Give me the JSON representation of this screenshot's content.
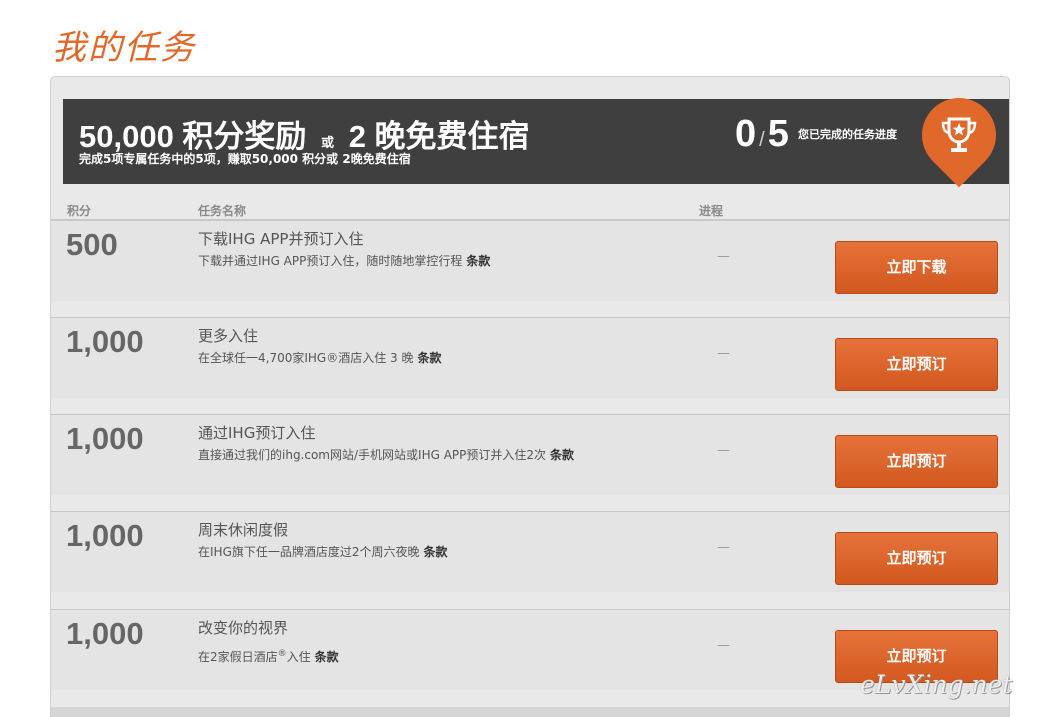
{
  "page": {
    "title": "我的任务"
  },
  "banner": {
    "points_reward": "50,000 积分奖励",
    "or_label": "或",
    "stay_reward": "2 晚免费住宿",
    "subtitle": "完成5项专属任务中的5项，赚取50,000 积分或 2晚免费住宿",
    "completed_count": "0",
    "total_count": "5",
    "progress_label": "您已完成的任务进度"
  },
  "badge": {
    "icon": "trophy-icon",
    "color": "#e0682a"
  },
  "columns": {
    "points": "积分",
    "task_name": "任务名称",
    "progress": "进程"
  },
  "tasks": [
    {
      "points": "500",
      "name": "下载IHG APP并预订入住",
      "desc": "下载并通过IHG APP预订入住，随时随地掌控行程",
      "desc_sup": "",
      "desc_tail": "",
      "terms": "条款",
      "progress": "—",
      "button": "立即下载"
    },
    {
      "points": "1,000",
      "name": "更多入住",
      "desc": "在全球任一4,700家IHG®酒店入住 3 晚",
      "desc_sup": "",
      "desc_tail": "",
      "terms": "条款",
      "progress": "—",
      "button": "立即预订"
    },
    {
      "points": "1,000",
      "name": "通过IHG预订入住",
      "desc": "直接通过我们的ihg.com网站/手机网站或IHG APP预订并入住2次",
      "desc_sup": "",
      "desc_tail": "",
      "terms": "条款",
      "progress": "—",
      "button": "立即预订"
    },
    {
      "points": "1,000",
      "name": "周末休闲度假",
      "desc": "在IHG旗下任一品牌酒店度过2个周六夜晚",
      "desc_sup": "",
      "desc_tail": "",
      "terms": "条款",
      "progress": "—",
      "button": "立即预订"
    },
    {
      "points": "1,000",
      "name": "改变你的视界",
      "desc": "在2家假日酒店",
      "desc_sup": "®",
      "desc_tail": "入住",
      "terms": "条款",
      "progress": "—",
      "button": "立即预订"
    }
  ],
  "watermark": "eLvXing.net",
  "colors": {
    "accent": "#e0682a",
    "banner_bg": "#3f3f3f",
    "panel_bg": "#e9e9e9"
  }
}
